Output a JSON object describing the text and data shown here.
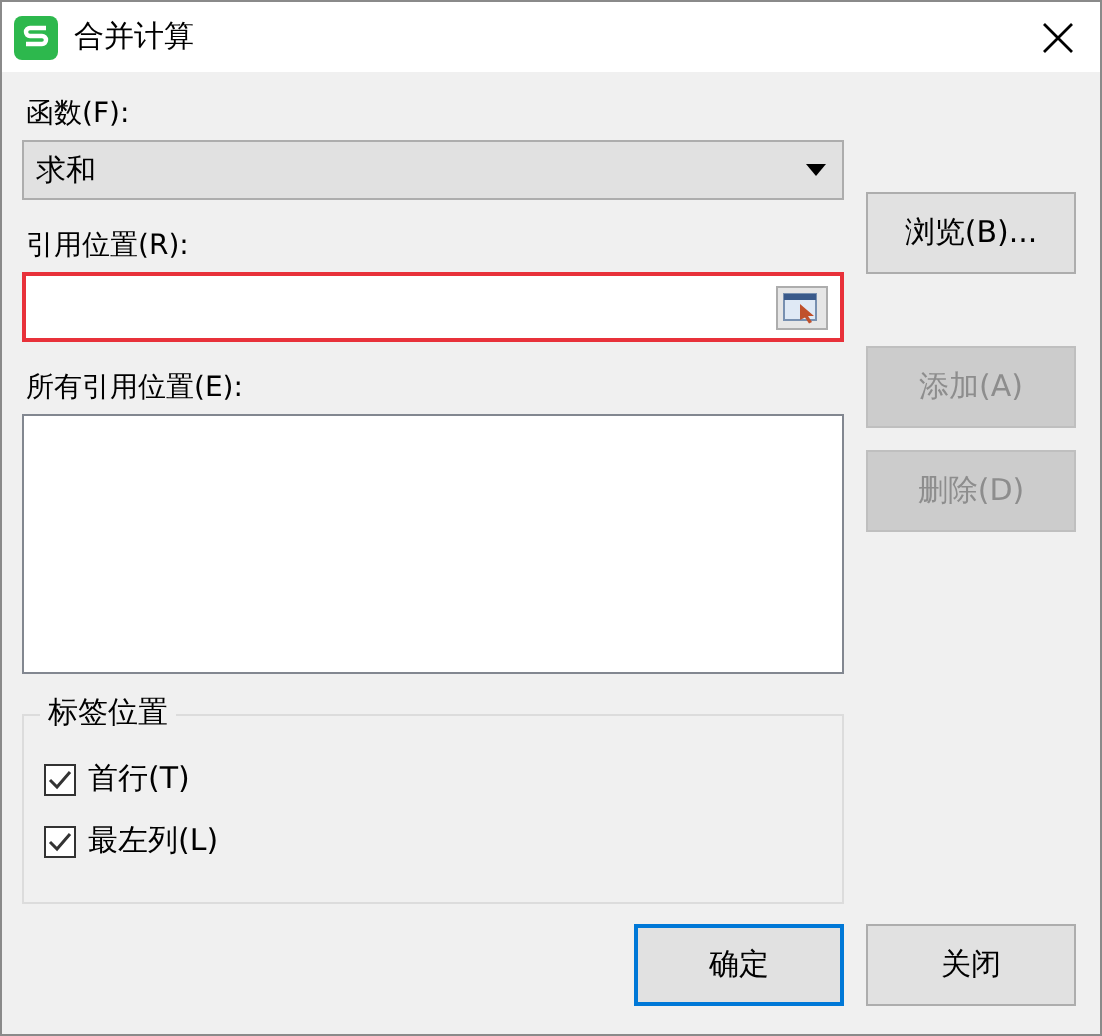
{
  "window": {
    "title": "合并计算"
  },
  "function": {
    "label": "函数(F):",
    "value": "求和"
  },
  "reference": {
    "label": "引用位置(R):",
    "highlighted": true
  },
  "browse_button": {
    "label": "浏览(B)...",
    "disabled": false
  },
  "all_references": {
    "label": "所有引用位置(E):"
  },
  "side_buttons": [
    {
      "label": "添加(A)",
      "disabled": true
    },
    {
      "label": "删除(D)",
      "disabled": true
    }
  ],
  "label_position": {
    "title": "标签位置",
    "options": [
      {
        "label": "首行(T)",
        "checked": true
      },
      {
        "label": "最左列(L)",
        "checked": true
      }
    ]
  },
  "buttons": [
    {
      "label": "确定",
      "default": true
    },
    {
      "label": "关闭",
      "default": false
    }
  ]
}
